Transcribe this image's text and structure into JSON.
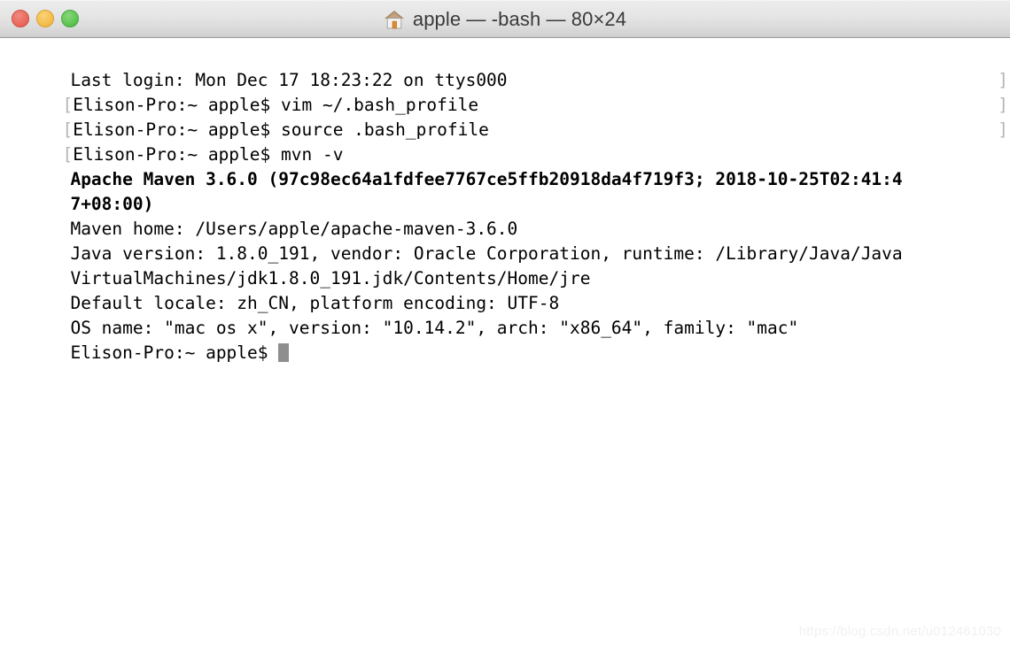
{
  "window": {
    "title": "apple — -bash — 80×24",
    "home_icon": "home-icon",
    "traffic_lights": {
      "close_label": "close",
      "minimize_label": "minimize",
      "zoom_label": "zoom",
      "close_color": "#eb6a5e",
      "minimize_color": "#f5bf4f",
      "zoom_color": "#61c555"
    }
  },
  "theme": {
    "background": "#ffffff",
    "foreground": "#000000",
    "titlebar_top": "#ececec",
    "titlebar_bottom": "#cfcfcf",
    "marker_color": "#b5b5b5",
    "cursor_color": "#8e8e8e",
    "roof_color": "#a98b68",
    "door_color": "#e08a33"
  },
  "terminal": {
    "columns": 80,
    "rows": 24,
    "prompt": "Elison-Pro:~ apple$ ",
    "bracket_open": "[",
    "bracket_close": "]",
    "lines": [
      {
        "text": "Last login: Mon Dec 17 18:23:22 on ttys000",
        "marker": false,
        "bold": false,
        "cursor": false
      },
      {
        "text": "Elison-Pro:~ apple$ vim ~/.bash_profile",
        "marker": true,
        "bold": false,
        "cursor": false
      },
      {
        "text": "Elison-Pro:~ apple$ source .bash_profile",
        "marker": true,
        "bold": false,
        "cursor": false
      },
      {
        "text": "Elison-Pro:~ apple$ mvn -v",
        "marker": true,
        "bold": false,
        "cursor": false
      },
      {
        "text": "Apache Maven 3.6.0 (97c98ec64a1fdfee7767ce5ffb20918da4f719f3; 2018-10-25T02:41:4",
        "marker": false,
        "bold": true,
        "cursor": false
      },
      {
        "text": "7+08:00)",
        "marker": false,
        "bold": true,
        "cursor": false
      },
      {
        "text": "Maven home: /Users/apple/apache-maven-3.6.0",
        "marker": false,
        "bold": false,
        "cursor": false
      },
      {
        "text": "Java version: 1.8.0_191, vendor: Oracle Corporation, runtime: /Library/Java/Java",
        "marker": false,
        "bold": false,
        "cursor": false
      },
      {
        "text": "VirtualMachines/jdk1.8.0_191.jdk/Contents/Home/jre",
        "marker": false,
        "bold": false,
        "cursor": false
      },
      {
        "text": "Default locale: zh_CN, platform encoding: UTF-8",
        "marker": false,
        "bold": false,
        "cursor": false
      },
      {
        "text": "OS name: \"mac os x\", version: \"10.14.2\", arch: \"x86_64\", family: \"mac\"",
        "marker": false,
        "bold": false,
        "cursor": false
      },
      {
        "text": "Elison-Pro:~ apple$ ",
        "marker": false,
        "bold": false,
        "cursor": true
      }
    ]
  },
  "watermark": {
    "text": "https://blog.csdn.net/u012461030"
  }
}
